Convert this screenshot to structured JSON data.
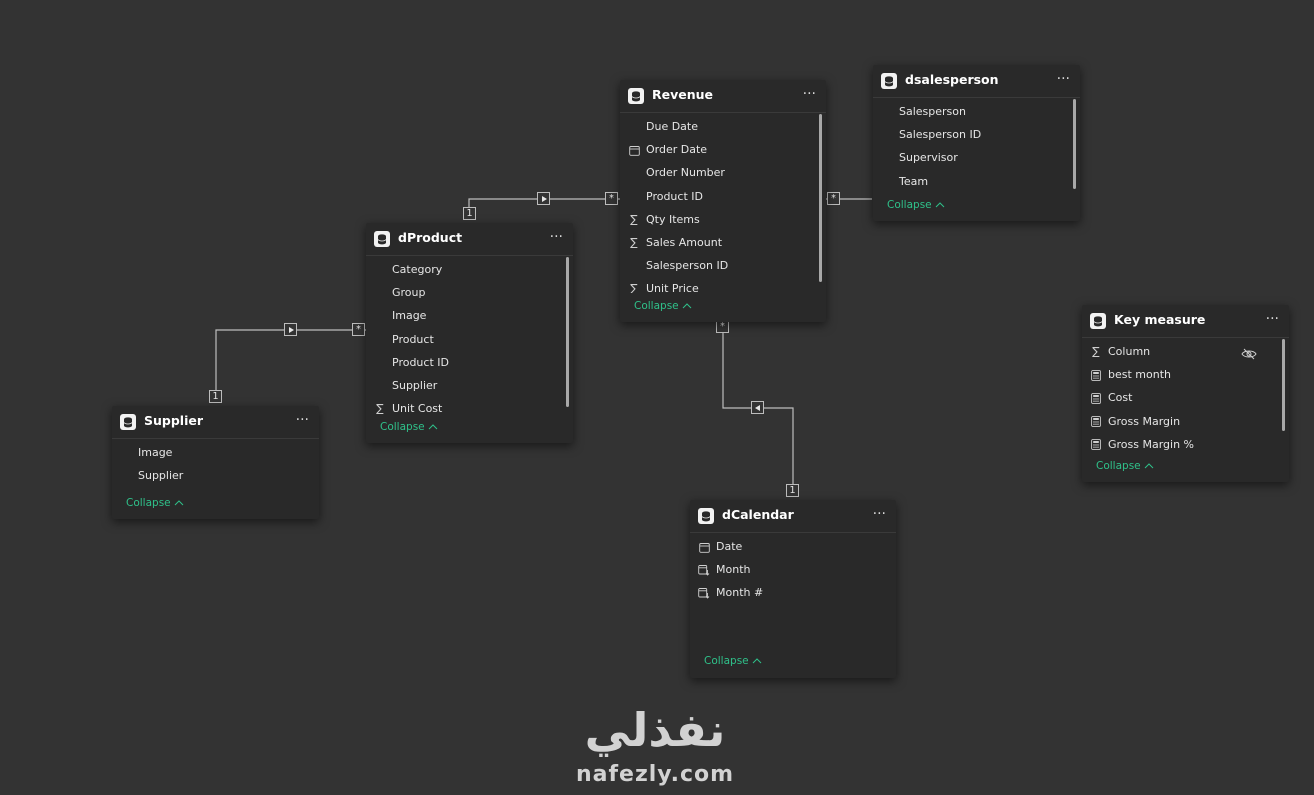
{
  "tables": {
    "revenue": {
      "title": "Revenue",
      "fields": [
        {
          "label": "Due Date",
          "icon": "none"
        },
        {
          "label": "Order Date",
          "icon": "calendar-icon"
        },
        {
          "label": "Order Number",
          "icon": "none"
        },
        {
          "label": "Product ID",
          "icon": "none"
        },
        {
          "label": "Qty Items",
          "icon": "sigma-icon"
        },
        {
          "label": "Sales Amount",
          "icon": "sigma-icon"
        },
        {
          "label": "Salesperson ID",
          "icon": "none"
        },
        {
          "label": "Unit Price",
          "icon": "sigma-icon"
        }
      ],
      "collapse": "Collapse"
    },
    "dsalesperson": {
      "title": "dsalesperson",
      "fields": [
        {
          "label": "Salesperson",
          "icon": "none"
        },
        {
          "label": "Salesperson ID",
          "icon": "none"
        },
        {
          "label": "Supervisor",
          "icon": "none"
        },
        {
          "label": "Team",
          "icon": "none"
        }
      ],
      "collapse": "Collapse"
    },
    "dproduct": {
      "title": "dProduct",
      "fields": [
        {
          "label": "Category",
          "icon": "none"
        },
        {
          "label": "Group",
          "icon": "none"
        },
        {
          "label": "Image",
          "icon": "none"
        },
        {
          "label": "Product",
          "icon": "none"
        },
        {
          "label": "Product ID",
          "icon": "none"
        },
        {
          "label": "Supplier",
          "icon": "none"
        },
        {
          "label": "Unit Cost",
          "icon": "sigma-icon"
        }
      ],
      "collapse": "Collapse"
    },
    "supplier": {
      "title": "Supplier",
      "fields": [
        {
          "label": "Image",
          "icon": "none"
        },
        {
          "label": "Supplier",
          "icon": "none"
        }
      ],
      "collapse": "Collapse"
    },
    "key_measure": {
      "title": "Key measure",
      "fields": [
        {
          "label": "Column",
          "icon": "sigma-icon",
          "hidden": true
        },
        {
          "label": "best month",
          "icon": "calculator-icon"
        },
        {
          "label": "Cost",
          "icon": "calculator-icon"
        },
        {
          "label": "Gross Margin",
          "icon": "calculator-icon"
        },
        {
          "label": "Gross Margin %",
          "icon": "calculator-icon"
        }
      ],
      "collapse": "Collapse"
    },
    "dcalendar": {
      "title": "dCalendar",
      "fields": [
        {
          "label": "Date",
          "icon": "calendar-icon"
        },
        {
          "label": "Month",
          "icon": "calendar-sort-icon"
        },
        {
          "label": "Month #",
          "icon": "calendar-sort-icon"
        }
      ],
      "collapse": "Collapse"
    }
  },
  "relationships": [
    {
      "one": "dProduct",
      "many": "Revenue",
      "one_label": "1",
      "many_label": "*",
      "direction": "single"
    },
    {
      "one": "dsalesperson",
      "many": "Revenue",
      "one_label": "",
      "many_label": "*",
      "direction": "single"
    },
    {
      "one": "Supplier",
      "many": "dProduct",
      "one_label": "1",
      "many_label": "*",
      "direction": "single"
    },
    {
      "one": "dCalendar",
      "many": "Revenue",
      "one_label": "1",
      "many_label": "*",
      "direction": "single"
    }
  ],
  "colors": {
    "canvas": "#333333",
    "card": "#292929",
    "accent": "#2fc18a",
    "line": "#bdbdbd"
  },
  "watermark": {
    "arabic": "نفذلي",
    "latin": "nafezly.com"
  }
}
